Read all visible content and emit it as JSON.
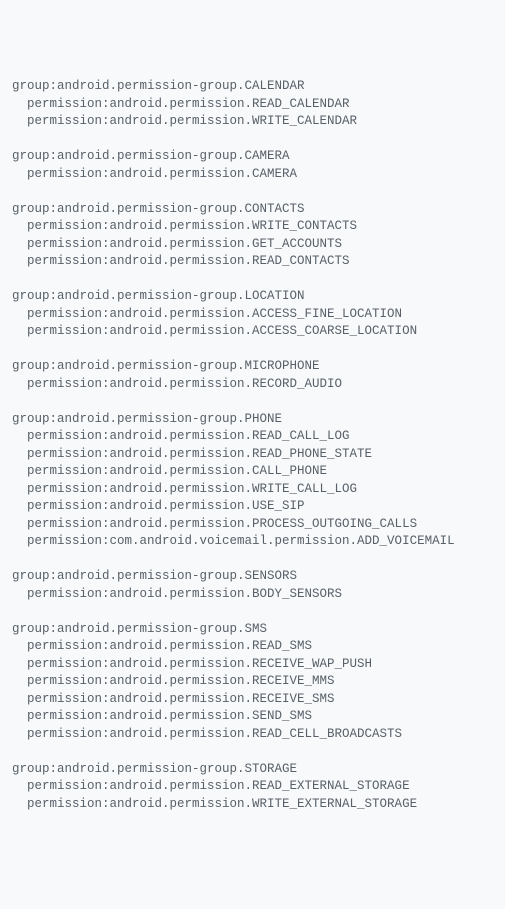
{
  "groups": [
    {
      "header": "group:android.permission-group.CALENDAR",
      "perms": [
        "  permission:android.permission.READ_CALENDAR",
        "  permission:android.permission.WRITE_CALENDAR"
      ]
    },
    {
      "header": "group:android.permission-group.CAMERA",
      "perms": [
        "  permission:android.permission.CAMERA"
      ]
    },
    {
      "header": "group:android.permission-group.CONTACTS",
      "perms": [
        "  permission:android.permission.WRITE_CONTACTS",
        "  permission:android.permission.GET_ACCOUNTS",
        "  permission:android.permission.READ_CONTACTS"
      ]
    },
    {
      "header": "group:android.permission-group.LOCATION",
      "perms": [
        "  permission:android.permission.ACCESS_FINE_LOCATION",
        "  permission:android.permission.ACCESS_COARSE_LOCATION"
      ]
    },
    {
      "header": "group:android.permission-group.MICROPHONE",
      "perms": [
        "  permission:android.permission.RECORD_AUDIO"
      ]
    },
    {
      "header": "group:android.permission-group.PHONE",
      "perms": [
        "  permission:android.permission.READ_CALL_LOG",
        "  permission:android.permission.READ_PHONE_STATE",
        "  permission:android.permission.CALL_PHONE",
        "  permission:android.permission.WRITE_CALL_LOG",
        "  permission:android.permission.USE_SIP",
        "  permission:android.permission.PROCESS_OUTGOING_CALLS",
        "  permission:com.android.voicemail.permission.ADD_VOICEMAIL"
      ]
    },
    {
      "header": "group:android.permission-group.SENSORS",
      "perms": [
        "  permission:android.permission.BODY_SENSORS"
      ]
    },
    {
      "header": "group:android.permission-group.SMS",
      "perms": [
        "  permission:android.permission.READ_SMS",
        "  permission:android.permission.RECEIVE_WAP_PUSH",
        "  permission:android.permission.RECEIVE_MMS",
        "  permission:android.permission.RECEIVE_SMS",
        "  permission:android.permission.SEND_SMS",
        "  permission:android.permission.READ_CELL_BROADCASTS"
      ]
    },
    {
      "header": "group:android.permission-group.STORAGE",
      "perms": [
        "  permission:android.permission.READ_EXTERNAL_STORAGE",
        "  permission:android.permission.WRITE_EXTERNAL_STORAGE"
      ]
    }
  ]
}
